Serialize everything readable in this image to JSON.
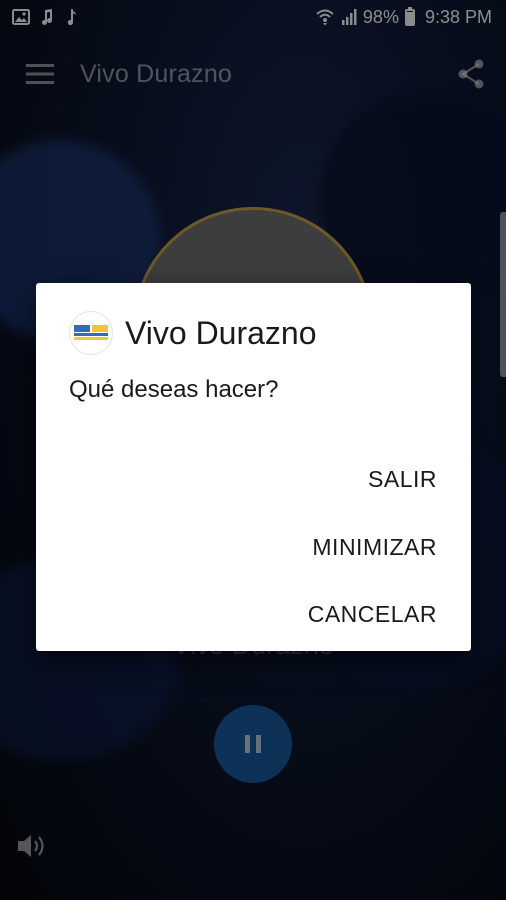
{
  "status_bar": {
    "battery": "98%",
    "time": "9:38 PM",
    "left_icons": [
      "image-icon",
      "music-note-icon",
      "music-note-icon"
    ],
    "right_icons": [
      "wifi-icon",
      "signal-icon",
      "battery-icon"
    ]
  },
  "toolbar": {
    "title": "Vivo Durazno",
    "menu_icon": "hamburger-menu-icon",
    "share_icon": "share-icon"
  },
  "player": {
    "station_name": "Vivo Durazno",
    "play_state_icon": "pause-icon",
    "volume_icon": "volume-icon"
  },
  "dialog": {
    "title": "Vivo Durazno",
    "message": "Qué deseas hacer?",
    "buttons": {
      "exit": "SALIR",
      "minimize": "MINIMIZAR",
      "cancel": "CANCELAR"
    }
  },
  "colors": {
    "accent": "#1a5aa0",
    "circle_border": "#c7a244",
    "dialog_bg": "#ffffff"
  }
}
